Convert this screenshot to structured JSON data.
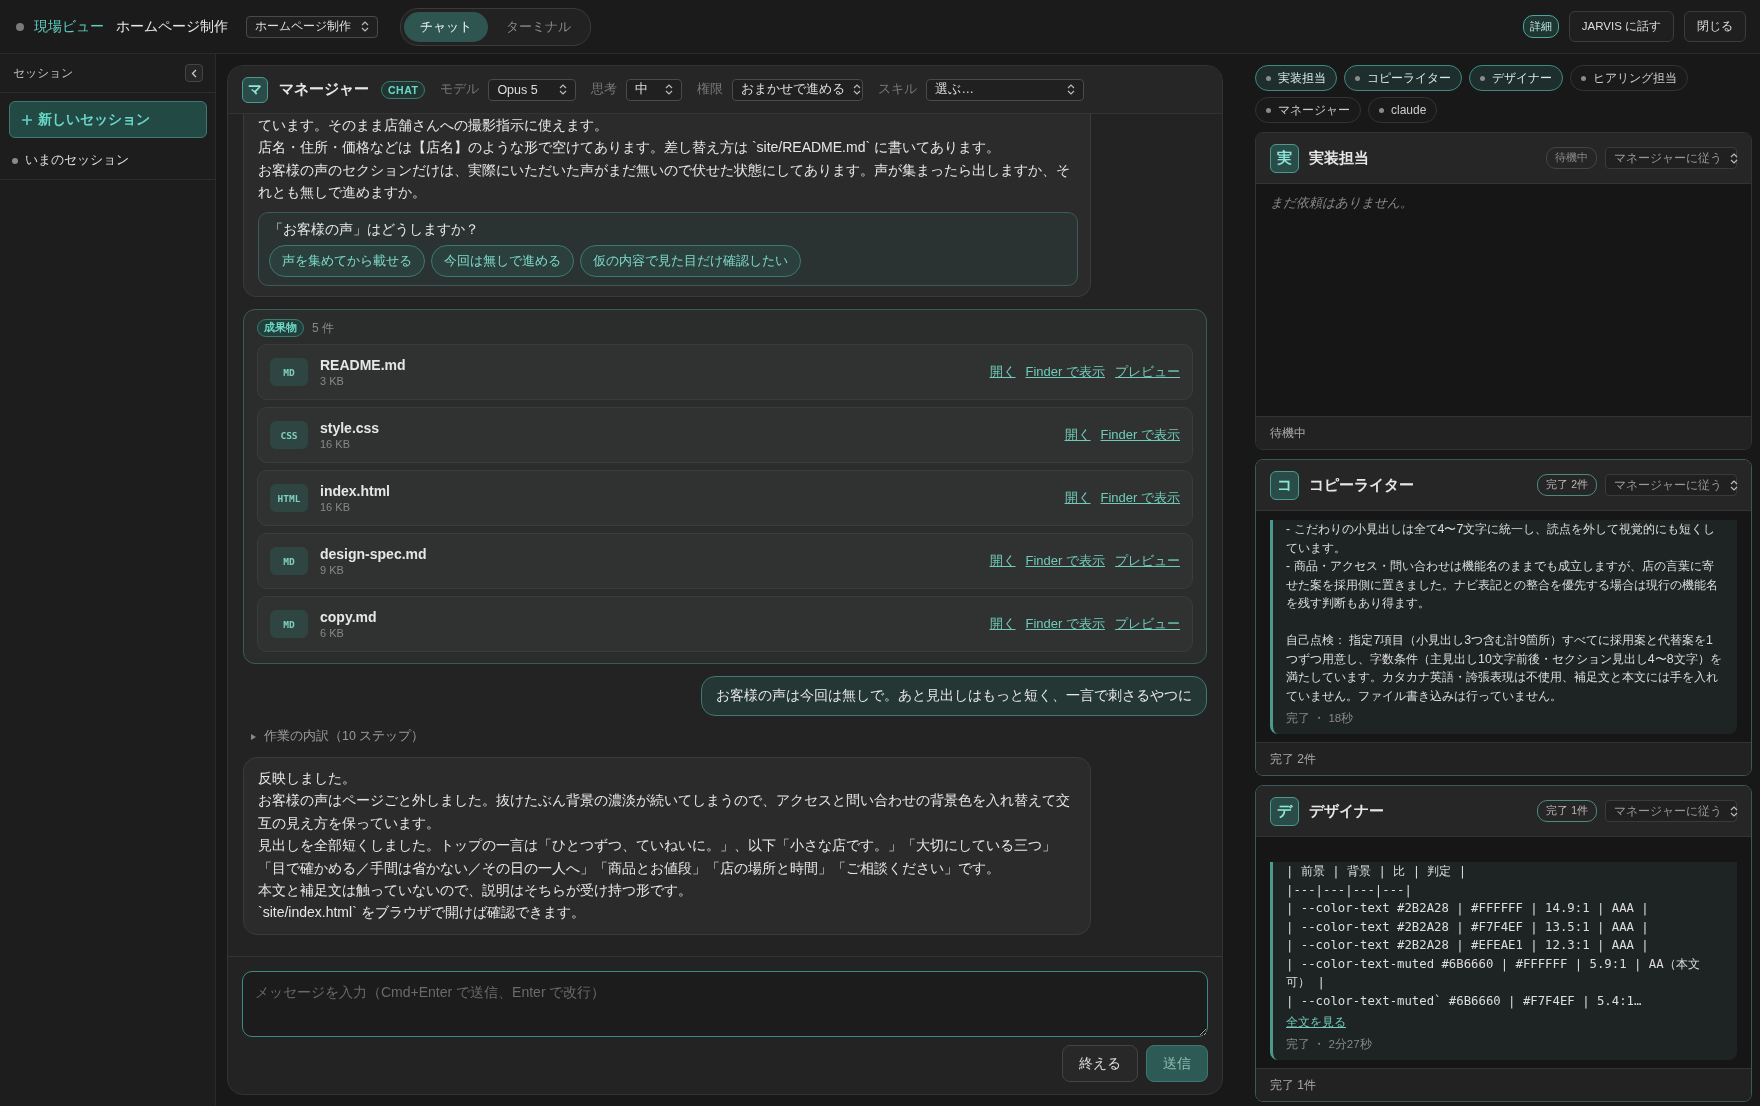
{
  "top_bar": {
    "view_label": "現場ビュー",
    "project": "ホームページ制作",
    "project_select": "ホームページ制作",
    "tabs": [
      {
        "label": "チャット",
        "selected": true
      },
      {
        "label": "ターミナル",
        "selected": false
      }
    ],
    "details_button": "詳細",
    "talk_button": "JARVIS に話す",
    "close_button": "閉じる"
  },
  "sidebar": {
    "title": "セッション",
    "new_session_button": "新しいセッション",
    "sessions": [
      {
        "label": "いまのセッション"
      }
    ]
  },
  "chat": {
    "header": {
      "avatar": "マ",
      "title": "マネージャー",
      "badge": "CHAT",
      "controls": [
        {
          "label": "モデル",
          "value": "Opus 5"
        },
        {
          "label": "思考",
          "value": "中"
        },
        {
          "label": "権限",
          "value": "おまかせで進める"
        },
        {
          "label": "スキル",
          "value": "選ぶ…"
        }
      ]
    },
    "messages": [
      {
        "kind": "assistant",
        "paragraphs": [
          "ています。そのまま店舗さんへの撮影指示に使えます。",
          "店名・住所・価格などは【店名】のような形で空けてあります。差し替え方は `site/README.md` に書いてあります。",
          "お客様の声のセクションだけは、実際にいただいた声がまだ無いので伏せた状態にしてあります。声が集まったら出しますか、それとも無しで進めますか。"
        ],
        "question": {
          "prompt": "「お客様の声」はどうしますか？",
          "options": [
            "声を集めてから載せる",
            "今回は無しで進める",
            "仮の内容で見た目だけ確認したい"
          ]
        }
      },
      {
        "kind": "artifacts",
        "badge": "成果物",
        "count": "5 件",
        "files": [
          {
            "type": "MD",
            "name": "README.md",
            "size": "3 KB",
            "actions": [
              "開く",
              "Finder で表示",
              "プレビュー"
            ]
          },
          {
            "type": "CSS",
            "name": "style.css",
            "size": "16 KB",
            "actions": [
              "開く",
              "Finder で表示"
            ]
          },
          {
            "type": "HTML",
            "name": "index.html",
            "size": "16 KB",
            "actions": [
              "開く",
              "Finder で表示"
            ]
          },
          {
            "type": "MD",
            "name": "design-spec.md",
            "size": "9 KB",
            "actions": [
              "開く",
              "Finder で表示",
              "プレビュー"
            ]
          },
          {
            "type": "MD",
            "name": "copy.md",
            "size": "6 KB",
            "actions": [
              "開く",
              "Finder で表示",
              "プレビュー"
            ]
          }
        ]
      },
      {
        "kind": "user",
        "text": "お客様の声は今回は無しで。あと見出しはもっと短く、一言で刺さるやつに"
      },
      {
        "kind": "steps",
        "text": "作業の内訳（10 ステップ）"
      },
      {
        "kind": "assistant",
        "paragraphs": [
          "反映しました。",
          "お客様の声はページごと外しました。抜けたぶん背景の濃淡が続いてしまうので、アクセスと問い合わせの背景色を入れ替えて交互の見え方を保っています。",
          "見出しを全部短くしました。トップの一言は「ひとつずつ、ていねいに。」、以下「小さな店です。」「大切にしている三つ」「目で確かめる／手間は省かない／その日の一人へ」「商品とお値段」「店の場所と時間」「ご相談ください」です。",
          "本文と補足文は触っていないので、説明はそちらが受け持つ形です。",
          "`site/index.html` をブラウザで開けば確認できます。"
        ]
      }
    ],
    "composer": {
      "placeholder": "メッセージを入力（Cmd+Enter で送信、Enter で改行）",
      "buttons": [
        {
          "label": "終える",
          "kind": "secondary"
        },
        {
          "label": "送信",
          "kind": "primary"
        }
      ]
    }
  },
  "agents": {
    "chips": [
      {
        "label": "実装担当",
        "active": true
      },
      {
        "label": "コピーライター",
        "active": true
      },
      {
        "label": "デザイナー",
        "active": true
      },
      {
        "label": "ヒアリング担当",
        "active": false
      },
      {
        "label": "マネージャー",
        "active": false
      },
      {
        "label": "claude",
        "active": false
      }
    ],
    "cards": [
      {
        "avatar": "実",
        "name": "実装担当",
        "status": "待機中",
        "done": false,
        "policy": "マネージャーに従う",
        "body": {
          "kind": "empty",
          "text": "まだ依頼はありません。"
        },
        "footer": "待機中"
      },
      {
        "avatar": "コ",
        "name": "コピーライター",
        "status": "完了 2件",
        "done": true,
        "policy": "マネージャーに従う",
        "body": {
          "kind": "log",
          "sections": [
            [
              "-  こだわりの小見出しは全て4〜7文字に統一し、読点を外して視覚的にも短くしています。",
              "-  商品・アクセス・問い合わせは機能名のままでも成立しますが、店の言葉に寄せた案を採用側に置きました。ナビ表記との整合を優先する場合は現行の機能名を残す判断もあり得ます。"
            ],
            [
              "自己点検：  指定7項目（小見出し3つ含む計9箇所）すべてに採用案と代替案を1つずつ用意し、字数条件（主見出し10文字前後・セクション見出し4〜8文字）を満たしています。カタカナ英語・誇張表現は不使用、補足文と本文には手を入れていません。ファイル書き込みは行っていません。"
            ]
          ],
          "meta": "完了 ・ 18秒"
        },
        "footer": "完了 2件"
      },
      {
        "avatar": "デ",
        "name": "デザイナー",
        "status": "完了 1件",
        "done": true,
        "policy": "マネージャーに従う",
        "body": {
          "kind": "code",
          "lines": [
            "| 前景 | 背景 | 比 | 判定 |",
            "|---|---|---|---|",
            "| --color-text #2B2A28 | #FFFFFF | 14.9:1 | AAA |",
            "| --color-text #2B2A28 | #F7F4EF | 13.5:1 | AAA |",
            "| --color-text #2B2A28 | #EFEAE1 | 12.3:1 | AAA |",
            "| --color-text-muted #6B6660 | #FFFFFF | 5.9:1 | AA（本文可） |",
            "| --color-text-muted` #6B6660 | #F7F4EF | 5.4:1…"
          ],
          "link": "全文を見る",
          "meta": "完了 ・ 2分27秒"
        },
        "footer": "完了 1件"
      }
    ]
  }
}
